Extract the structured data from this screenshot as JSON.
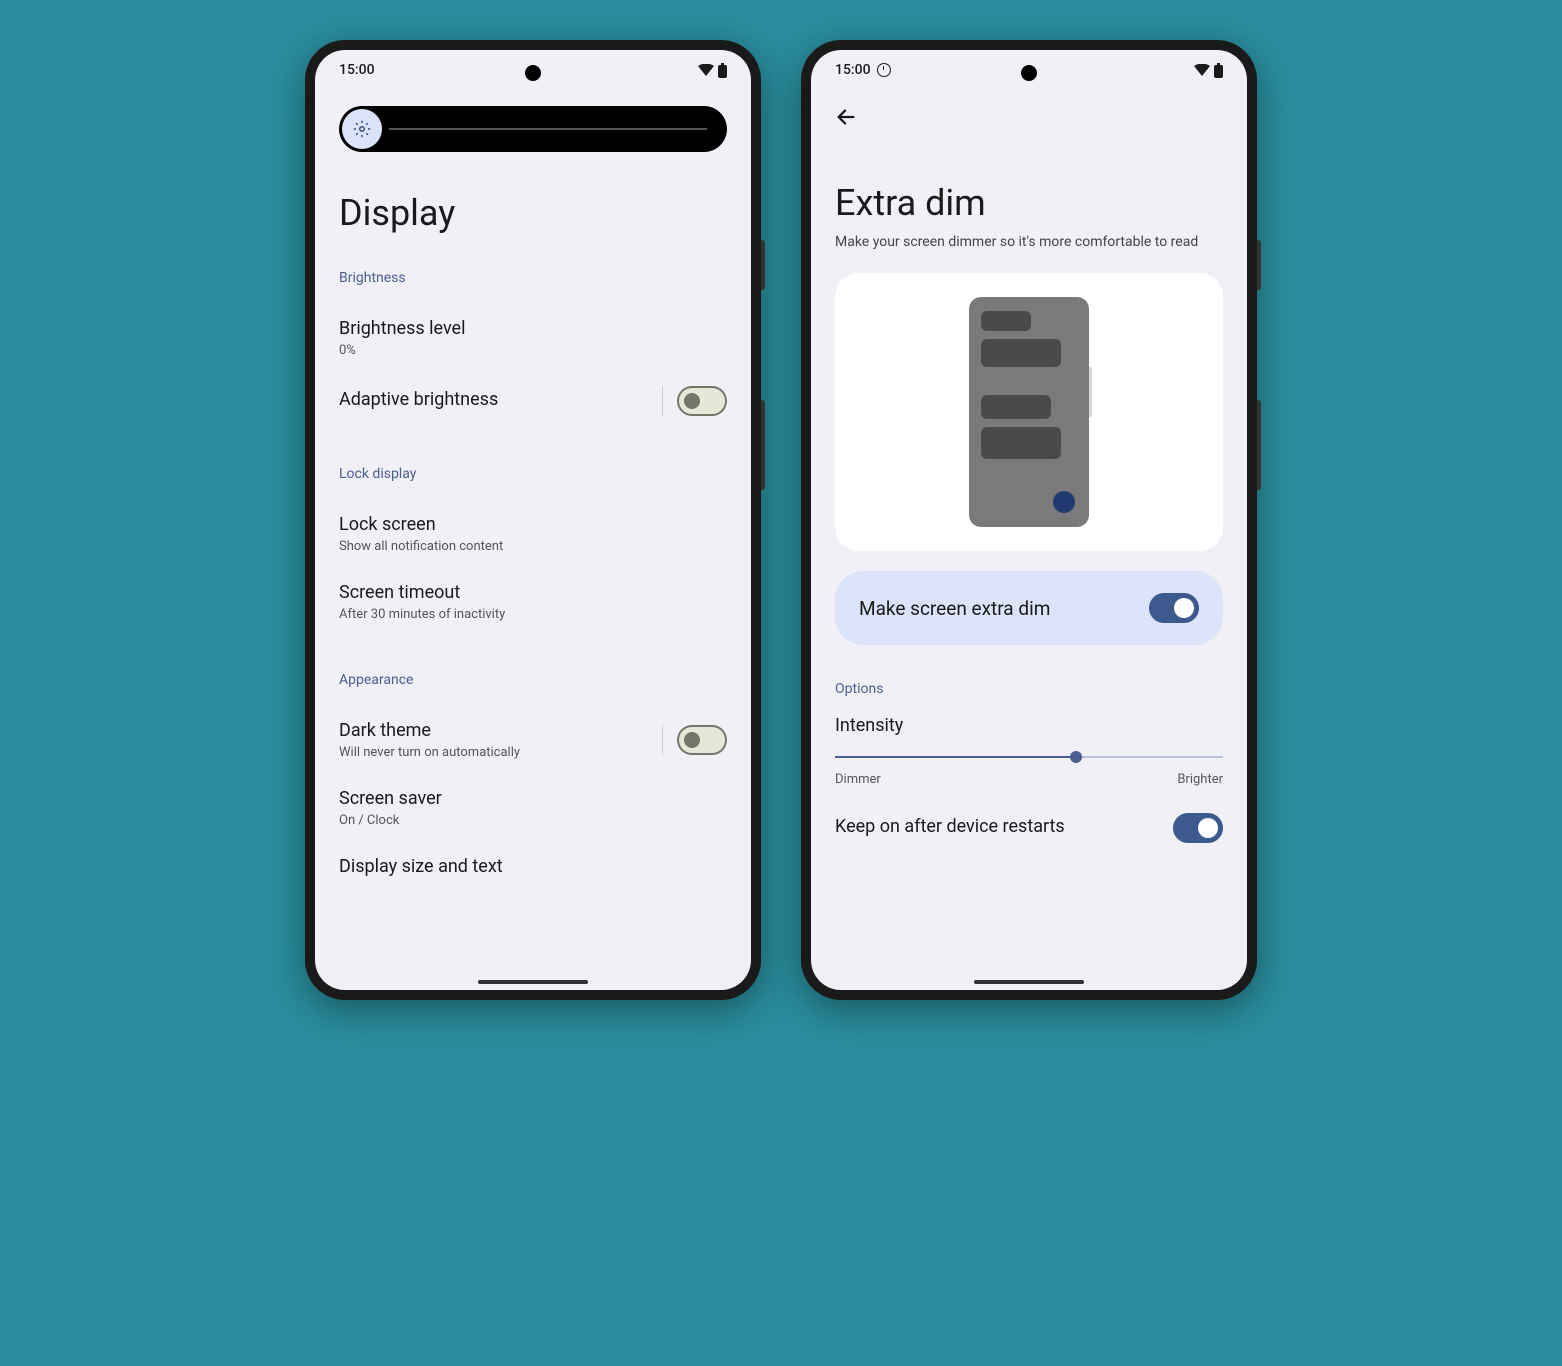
{
  "status": {
    "time": "15:00"
  },
  "left": {
    "title": "Display",
    "brightness_section": "Brightness",
    "brightness_level": {
      "title": "Brightness level",
      "sub": "0%"
    },
    "adaptive": {
      "title": "Adaptive brightness"
    },
    "lock_section": "Lock display",
    "lock_screen": {
      "title": "Lock screen",
      "sub": "Show all notification content"
    },
    "timeout": {
      "title": "Screen timeout",
      "sub": "After 30 minutes of inactivity"
    },
    "appearance_section": "Appearance",
    "dark": {
      "title": "Dark theme",
      "sub": "Will never turn on automatically"
    },
    "saver": {
      "title": "Screen saver",
      "sub": "On / Clock"
    },
    "size": {
      "title": "Display size and text"
    }
  },
  "right": {
    "title": "Extra dim",
    "subtitle": "Make your screen dimmer so it's more comfortable to read",
    "main_toggle": "Make screen extra dim",
    "options_section": "Options",
    "intensity": {
      "title": "Intensity",
      "min": "Dimmer",
      "max": "Brighter"
    },
    "keep_on": "Keep on after device restarts"
  }
}
